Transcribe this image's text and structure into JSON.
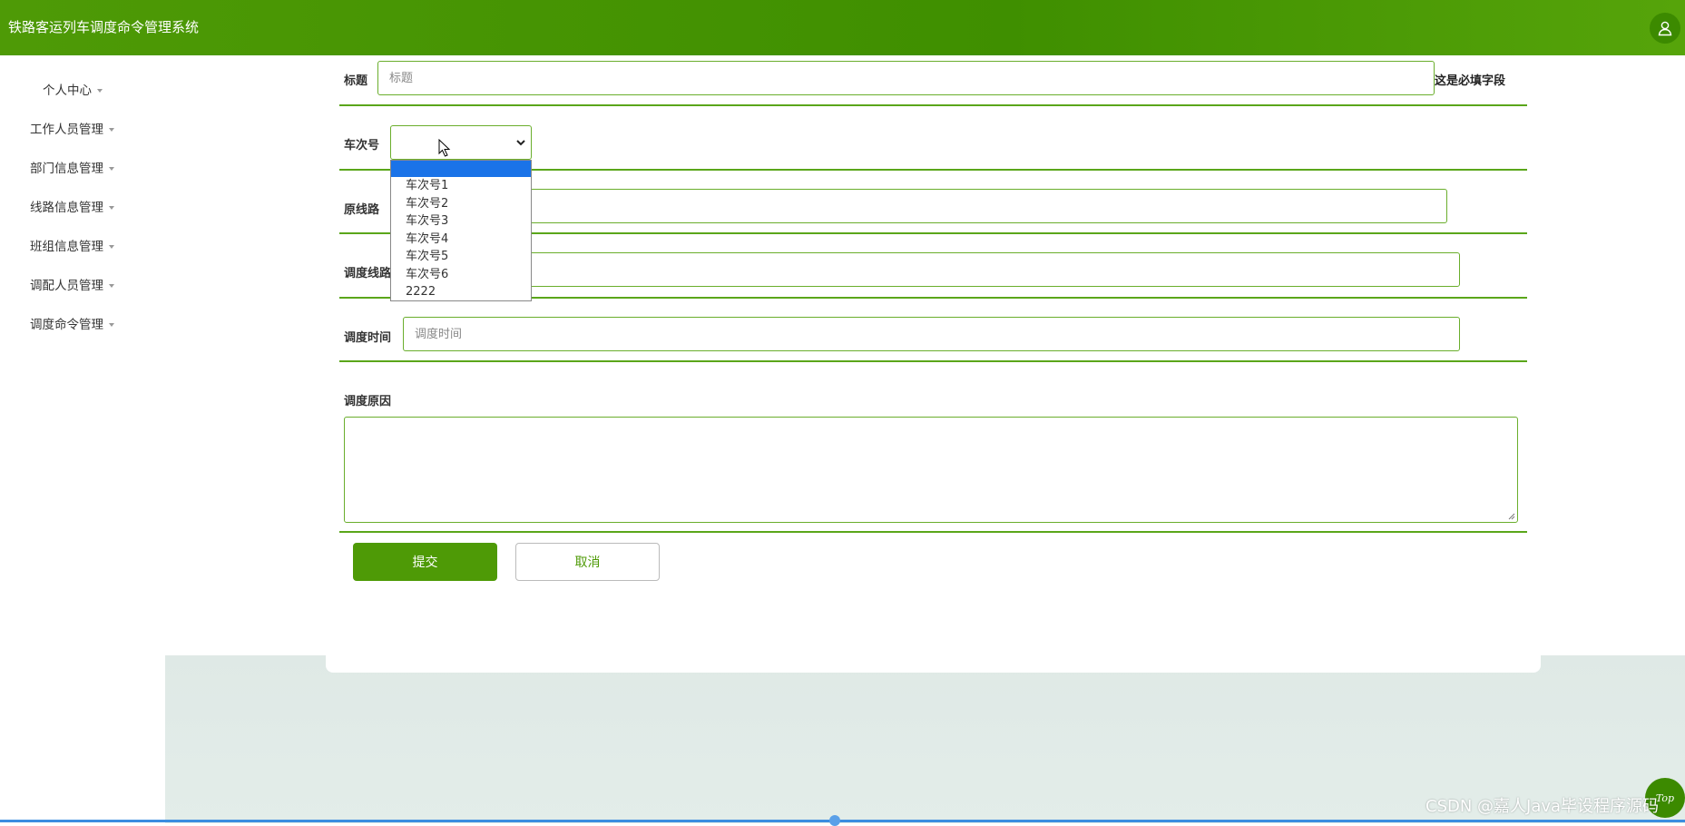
{
  "header": {
    "title": "铁路客运列车调度命令管理系统",
    "user_icon": "user-icon"
  },
  "sidebar": {
    "items": [
      {
        "label": "个人中心"
      },
      {
        "label": "工作人员管理"
      },
      {
        "label": "部门信息管理"
      },
      {
        "label": "线路信息管理"
      },
      {
        "label": "班组信息管理"
      },
      {
        "label": "调配人员管理"
      },
      {
        "label": "调度命令管理"
      }
    ]
  },
  "form": {
    "title": {
      "label": "标题",
      "placeholder": "标题",
      "required_note": "这是必填字段"
    },
    "train": {
      "label": "车次号",
      "value": "",
      "options": [
        "",
        "车次号1",
        "车次号2",
        "车次号3",
        "车次号4",
        "车次号5",
        "车次号6",
        "2222"
      ]
    },
    "original_route": {
      "label": "原线路"
    },
    "dispatch_route": {
      "label": "调度线路"
    },
    "dispatch_time": {
      "label": "调度时间",
      "placeholder": "调度时间"
    },
    "reason": {
      "label": "调度原因"
    },
    "submit_label": "提交",
    "cancel_label": "取消"
  },
  "footer": {
    "top_label": "Top",
    "watermark": "CSDN @嘉人Java毕设程序源码"
  },
  "colors": {
    "primary": "#4e9a06",
    "border": "#6aae2c",
    "selected": "#1a73e8"
  }
}
